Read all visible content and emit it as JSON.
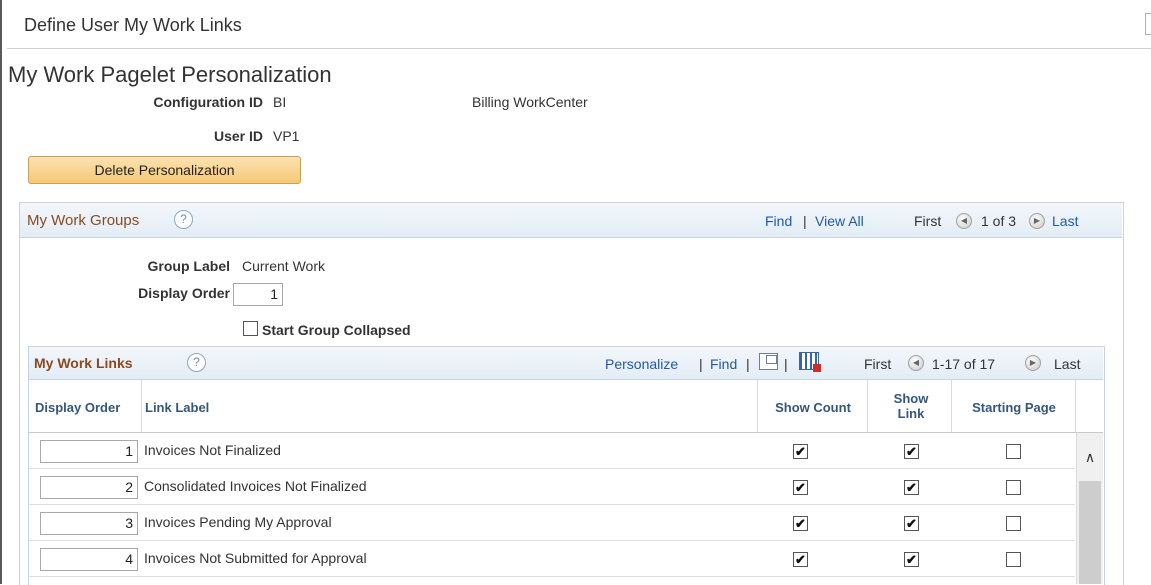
{
  "window": {
    "title": "Define User My Work Links"
  },
  "page": {
    "title": "My Work Pagelet Personalization"
  },
  "config": {
    "config_id_label": "Configuration ID",
    "config_id_value": "BI",
    "config_desc": "Billing WorkCenter",
    "user_id_label": "User ID",
    "user_id_value": "VP1"
  },
  "delete_button": "Delete Personalization",
  "groups": {
    "title": "My Work Groups",
    "help": "?",
    "find": "Find",
    "view_all": "View All",
    "sep": "|",
    "first": "First",
    "range": "1 of 3",
    "last": "Last",
    "group_label_label": "Group Label",
    "group_label_value": "Current Work",
    "display_order_label": "Display Order",
    "display_order_value": "1",
    "start_collapsed_label": "Start Group Collapsed"
  },
  "links": {
    "title": "My Work Links",
    "help": "?",
    "personalize": "Personalize",
    "find": "Find",
    "sep": "|",
    "first": "First",
    "range": "1-17 of 17",
    "last": "Last",
    "columns": {
      "display_order": "Display Order",
      "link_label": "Link Label",
      "show_count": "Show Count",
      "show_link_1": "Show",
      "show_link_2": "Link",
      "starting_page": "Starting Page"
    },
    "rows": [
      {
        "order": "1",
        "label": "Invoices Not Finalized",
        "show_count": true,
        "show_link": true,
        "starting_page": false
      },
      {
        "order": "2",
        "label": "Consolidated Invoices Not Finalized",
        "show_count": true,
        "show_link": true,
        "starting_page": false
      },
      {
        "order": "3",
        "label": "Invoices Pending My Approval",
        "show_count": true,
        "show_link": true,
        "starting_page": false
      },
      {
        "order": "4",
        "label": "Invoices Not Submitted for Approval",
        "show_count": true,
        "show_link": true,
        "starting_page": false
      }
    ]
  },
  "icons": {
    "check": "✔",
    "scroll_up": "∧",
    "prev": "◀",
    "next": "▶"
  },
  "colors": {
    "link": "#1f5aa6",
    "section_title": "#8a4a21",
    "button_fill": "#f5c877"
  }
}
